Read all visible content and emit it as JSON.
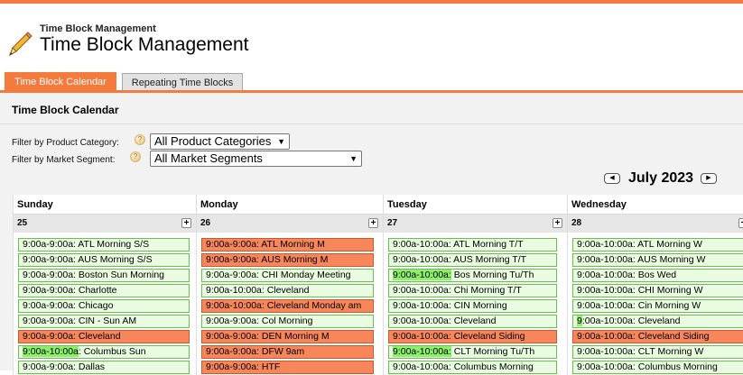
{
  "header": {
    "sup_title": "Time Block Management",
    "title": "Time Block Management",
    "logo_icon": "pencil-icon"
  },
  "tabs": [
    {
      "label": "Time Block Calendar",
      "active": true
    },
    {
      "label": "Repeating Time Blocks",
      "active": false
    }
  ],
  "panel": {
    "title": "Time Block Calendar"
  },
  "filters": {
    "product_label": "Filter by Product Category:",
    "product_value": "All Product Categories",
    "market_label": "Filter by Market Segment:",
    "market_value": "All Market Segments"
  },
  "calendar": {
    "month_label": "July 2023",
    "prev_label": "◀",
    "next_label": "▶",
    "days": [
      {
        "name": "Sunday",
        "date": "25",
        "events": [
          {
            "text": "9:00a-9:00a: ATL Morning S/S",
            "status": "green"
          },
          {
            "text": "9:00a-9:00a: AUS Morning S/S",
            "status": "green"
          },
          {
            "text": "9:00a-9:00a: Boston Sun Morning",
            "status": "green"
          },
          {
            "text": "9:00a-9:00a: Charlotte",
            "status": "green"
          },
          {
            "text": "9:00a-9:00a: Chicago",
            "status": "green"
          },
          {
            "text": "9:00a-9:00a: CIN - Sun AM",
            "status": "green"
          },
          {
            "text": "9:00a-9:00a: Cleveland",
            "status": "red"
          },
          {
            "text": "9:00a-10:00a: Columbus Sun",
            "status": "green",
            "highlight": "9:00a-10:00a"
          },
          {
            "text": "9:00a-9:00a: Dallas",
            "status": "green"
          }
        ]
      },
      {
        "name": "Monday",
        "date": "26",
        "events": [
          {
            "text": "9:00a-9:00a: ATL Morning M",
            "status": "red"
          },
          {
            "text": "9:00a-9:00a: AUS Morning M",
            "status": "red"
          },
          {
            "text": "9:00a-9:00a: CHI Monday Meeting",
            "status": "green"
          },
          {
            "text": "9:00a-10:00a: Cleveland",
            "status": "green"
          },
          {
            "text": "9:00a-10:00a: Cleveland Monday am",
            "status": "red"
          },
          {
            "text": "9:00a-9:00a: Col Morning",
            "status": "green"
          },
          {
            "text": "9:00a-9:00a: DEN Morning M",
            "status": "red"
          },
          {
            "text": "9:00a-9:00a: DFW 9am",
            "status": "red"
          },
          {
            "text": "9:00a-9:00a: HTF",
            "status": "red"
          }
        ]
      },
      {
        "name": "Tuesday",
        "date": "27",
        "events": [
          {
            "text": "9:00a-10:00a: ATL Morning T/T",
            "status": "green"
          },
          {
            "text": "9:00a-10:00a: AUS Morning T/T",
            "status": "green"
          },
          {
            "text": "9:00a-10:00a: Bos Morning Tu/Th",
            "status": "green",
            "highlight": "9:00a-10:00a:"
          },
          {
            "text": "9:00a-10:00a: Chi Morning T/T",
            "status": "green"
          },
          {
            "text": "9:00a-10:00a: CIN Morning",
            "status": "green"
          },
          {
            "text": "9:00a-10:00a: Cleveland",
            "status": "green"
          },
          {
            "text": "9:00a-10:00a: Cleveland Siding",
            "status": "red"
          },
          {
            "text": "9:00a-10:00a: CLT Morning Tu/Th",
            "status": "green",
            "highlight": "9:00a-10:00a:"
          },
          {
            "text": "9:00a-10:00a: Columbus Morning",
            "status": "green"
          }
        ]
      },
      {
        "name": "Wednesday",
        "date": "28",
        "events": [
          {
            "text": "9:00a-10:00a: ATL Morning W",
            "status": "green"
          },
          {
            "text": "9:00a-10:00a: AUS Morning W",
            "status": "green"
          },
          {
            "text": "9:00a-10:00a: Bos Wed",
            "status": "green"
          },
          {
            "text": "9:00a-10:00a: CHI Morning W",
            "status": "green"
          },
          {
            "text": "9:00a-10:00a: Cin Morning W",
            "status": "green"
          },
          {
            "text": "9:00a-10:00a: Cleveland",
            "status": "green",
            "highlight": "9"
          },
          {
            "text": "9:00a-10:00a: Cleveland Siding",
            "status": "red"
          },
          {
            "text": "9:00a-10:00a: CLT Morning W",
            "status": "green"
          },
          {
            "text": "9:00a-10:00a: Columbus Morning",
            "status": "green"
          }
        ]
      }
    ]
  },
  "colors": {
    "accent": "#f47b3d",
    "event_green_bg": "#e9fbe0",
    "event_green_border": "#6bbf4e",
    "event_red_bg": "#f7865a",
    "event_highlight": "#8df06a"
  }
}
